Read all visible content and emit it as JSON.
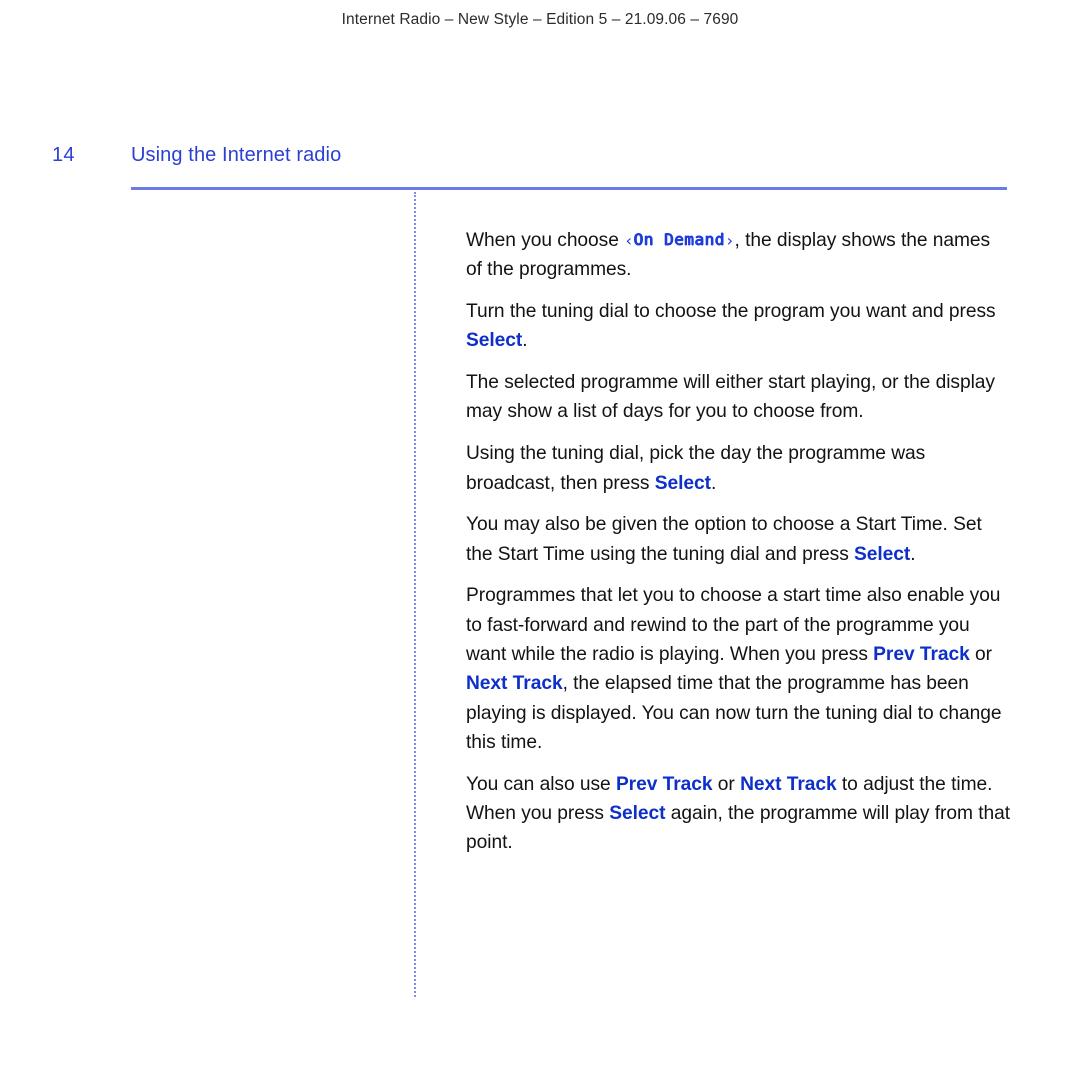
{
  "document": {
    "running_header": "Internet Radio – New Style – Edition 5 – 21.09.06 – 7690",
    "page_number": "14",
    "chapter_title": "Using the Internet radio"
  },
  "colors": {
    "heading_blue": "#2b3fd4",
    "rule_blue": "#6a7ae8",
    "button_blue": "#0e2fc9",
    "lcd_blue": "#1e3cdc",
    "body_text": "#131313"
  },
  "body": {
    "p1": {
      "part1": "When you choose ",
      "lcd_open": "‹",
      "lcd_value": "On Demand",
      "lcd_close": "›",
      "part2": ", the display shows the names of the programmes."
    },
    "p2": {
      "part1": "Turn the tuning dial to choose the program you want and press ",
      "button1": "Select",
      "part2": "."
    },
    "p3": {
      "text": "The selected programme will either start playing, or the display may show a list of days for you to choose from."
    },
    "p4": {
      "part1": "Using the tuning dial, pick the day the programme was broadcast, then press ",
      "button1": "Select",
      "part2": "."
    },
    "p5": {
      "part1": "You may also be given the option to choose a Start Time. Set the Start Time using the tuning dial and press ",
      "button1": "Select",
      "part2": "."
    },
    "p6": {
      "part1": "Programmes that let you to choose a start time also enable you to fast-forward and rewind to the part of the programme you want while the radio is playing. When you press ",
      "button1": "Prev Track",
      "part2": " or ",
      "button2": "Next Track",
      "part3": ", the elapsed time that the programme has been playing is displayed. You can now turn the tuning dial to change this time."
    },
    "p7": {
      "part1": "You can also use ",
      "button1": "Prev Track",
      "part2": " or ",
      "button2": "Next Track",
      "part3": " to adjust the time. When you press ",
      "button3": "Select",
      "part4": " again, the programme will play from that point."
    }
  }
}
